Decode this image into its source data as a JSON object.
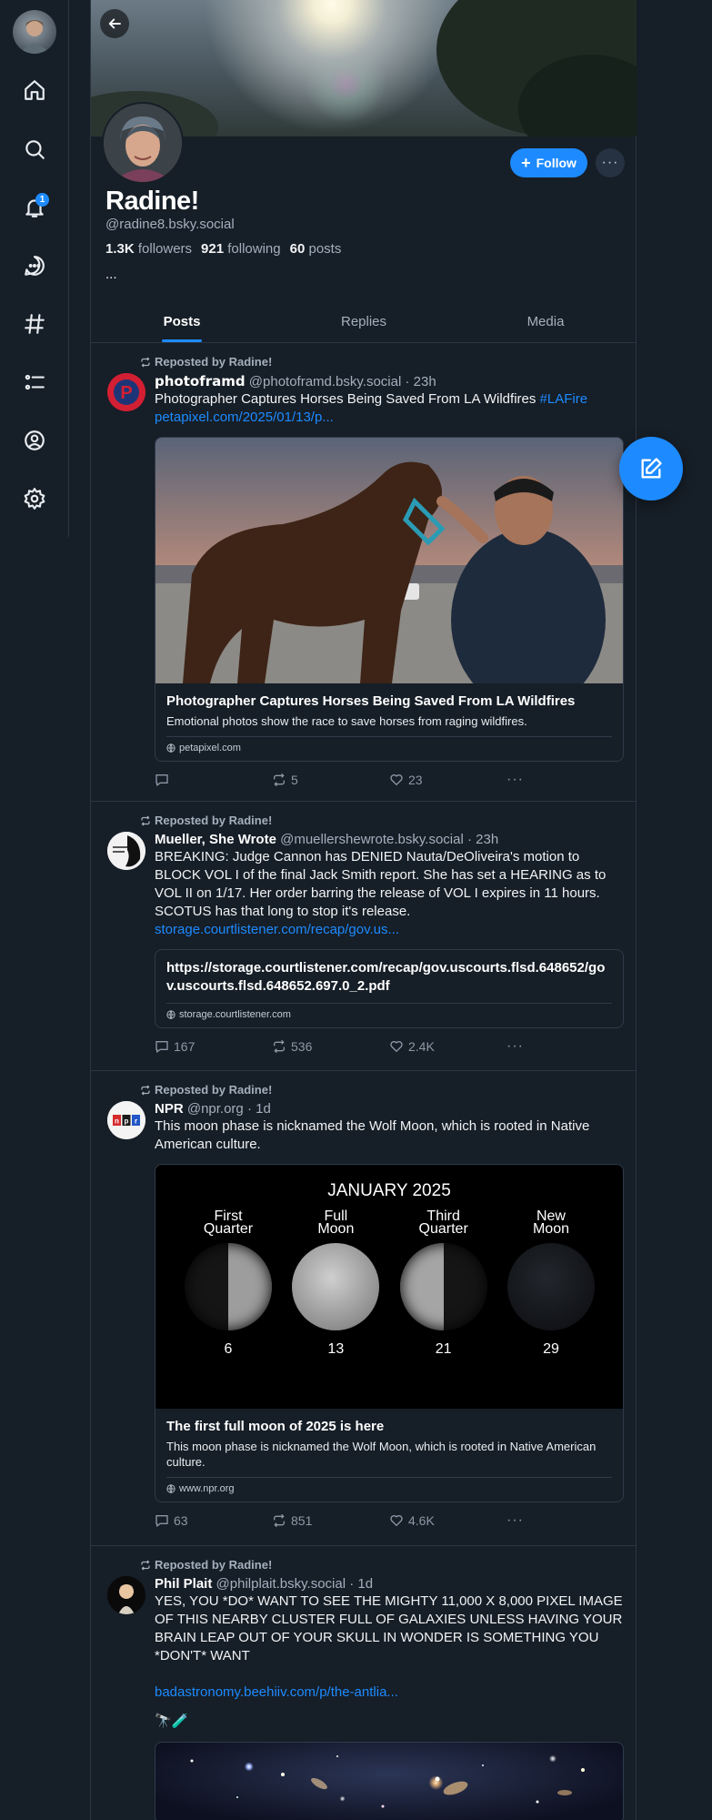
{
  "nav": {
    "notifications_badge": "1"
  },
  "profile": {
    "display_name": "Radine!",
    "handle": "@radine8.bsky.social",
    "followers_count": "1.3K",
    "followers_label": "followers",
    "following_count": "921",
    "following_label": "following",
    "posts_count": "60",
    "posts_label": "posts",
    "bio": "...",
    "follow_label": "Follow",
    "more_label": "···"
  },
  "tabs": [
    "Posts",
    "Replies",
    "Media"
  ],
  "posts": [
    {
      "repost_label": "Reposted by Radine!",
      "author": "𝗽𝗵𝗼𝘁𝗼𝗳𝗿𝗮𝗺𝗱",
      "handle": "@photoframd.bsky.social",
      "time": "· 23h",
      "text": "Photographer Captures Horses Being Saved From LA Wildfires",
      "hashtag": "#LAFire",
      "link": "petapixel.com/2025/01/13/p...",
      "card_title": "Photographer Captures Horses Being Saved From LA Wildfires",
      "card_desc": "Emotional photos show the race to save horses from raging wildfires.",
      "card_domain": "petapixel.com",
      "replies": "",
      "reposts": "5",
      "likes": "23"
    },
    {
      "repost_label": "Reposted by Radine!",
      "author": "Mueller, She Wrote",
      "handle": "@muellershewrote.bsky.social",
      "time": "· 23h",
      "text": "BREAKING: Judge Cannon has DENIED Nauta/DeOliveira's motion to BLOCK VOL I of the final Jack Smith report. She has set a HEARING as to VOL II on 1/17. Her order barring the release of VOL I expires in 11 hours. SCOTUS has that long to stop it's release.",
      "link": "storage.courtlistener.com/recap/gov.us...",
      "card_title": "https://storage.courtlistener.com/recap/gov.uscourts.flsd.648652/gov.uscourts.flsd.648652.697.0_2.pdf",
      "card_domain": "storage.courtlistener.com",
      "replies": "167",
      "reposts": "536",
      "likes": "2.4K"
    },
    {
      "repost_label": "Reposted by Radine!",
      "author": "NPR",
      "handle": "@npr.org",
      "time": "· 1d",
      "text": "This moon phase is nicknamed the Wolf Moon, which is rooted in Native American culture.",
      "image_title": "JANUARY 2025",
      "moons": [
        {
          "l1": "First",
          "l2": "Quarter",
          "day": "6"
        },
        {
          "l1": "Full",
          "l2": "Moon",
          "day": "13"
        },
        {
          "l1": "Third",
          "l2": "Quarter",
          "day": "21"
        },
        {
          "l1": "New",
          "l2": "Moon",
          "day": "29"
        }
      ],
      "card_title": "The first full moon of 2025 is here",
      "card_desc": "This moon phase is nicknamed the Wolf Moon, which is rooted in Native American culture.",
      "card_domain": "www.npr.org",
      "replies": "63",
      "reposts": "851",
      "likes": "4.6K"
    },
    {
      "repost_label": "Reposted by Radine!",
      "author": "Phil Plait",
      "handle": "@philplait.bsky.social",
      "time": "· 1d",
      "text": "YES, YOU *DO* WANT TO SEE THE MIGHTY 11,000 X 8,000 PIXEL IMAGE OF THIS NEARBY CLUSTER FULL OF GALAXIES UNLESS HAVING YOUR BRAIN LEAP OUT OF YOUR SKULL IN WONDER IS SOMETHING YOU *DON'T* WANT",
      "link": "badastronomy.beehiiv.com/p/the-antlia...",
      "emoji": "🔭🧪"
    }
  ]
}
